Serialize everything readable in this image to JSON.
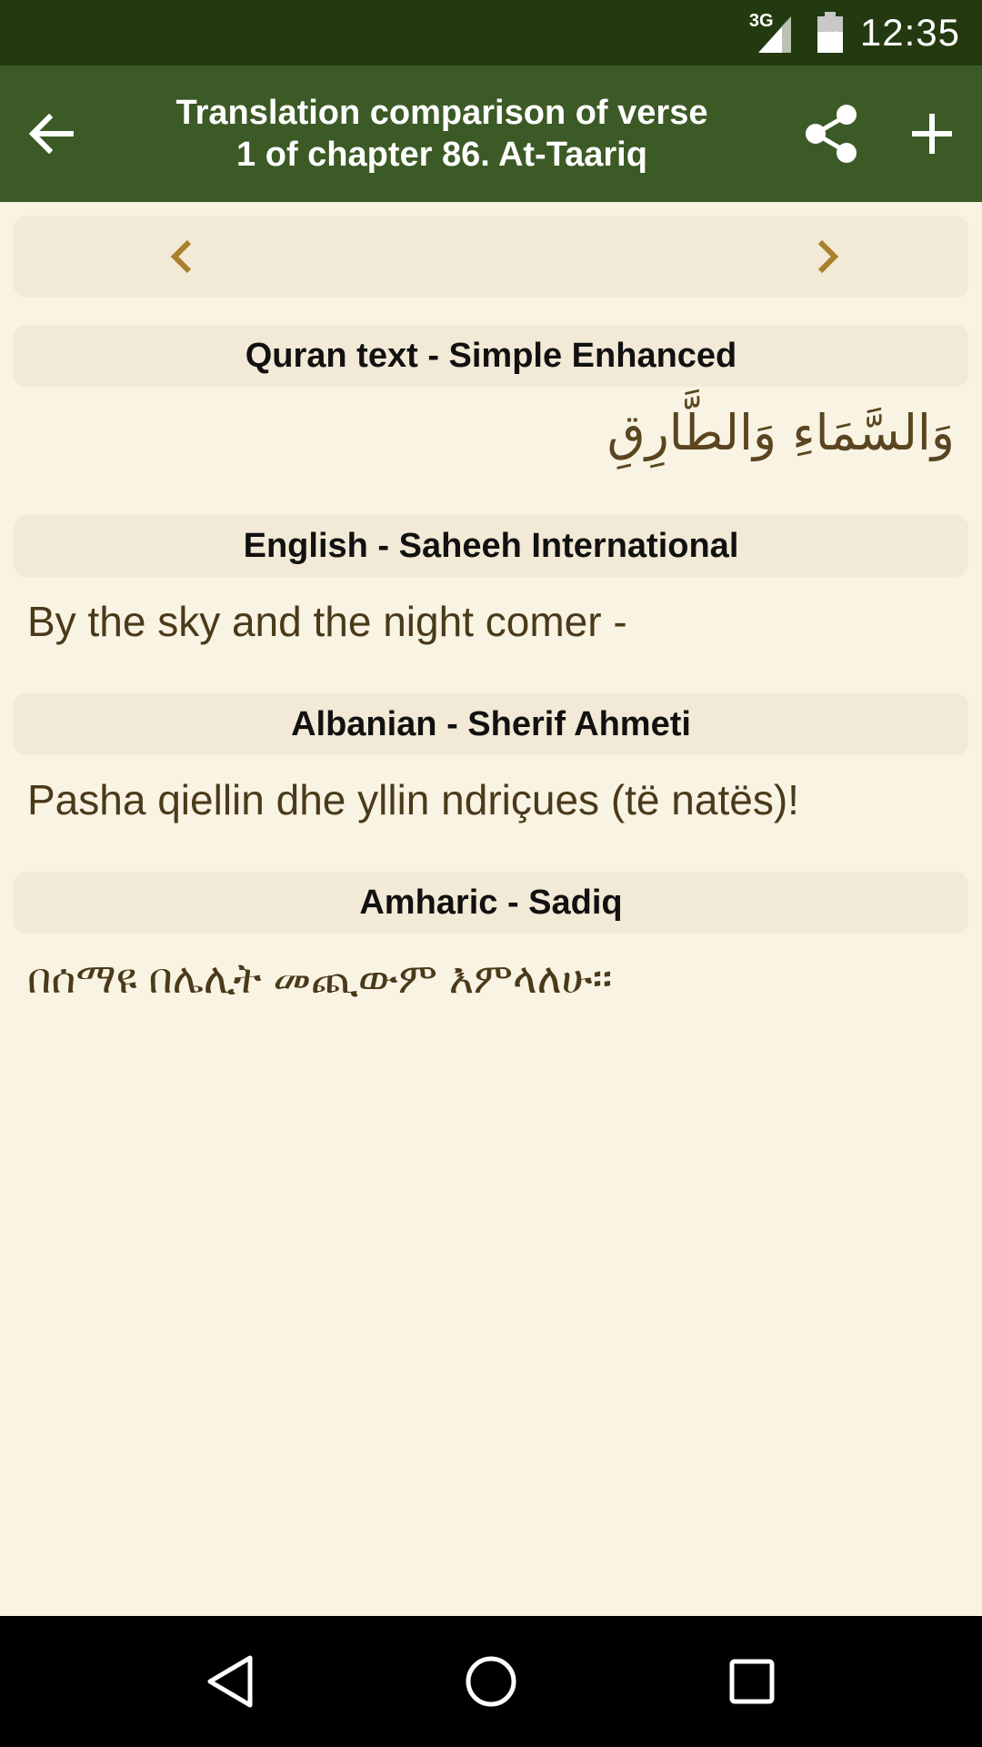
{
  "status": {
    "network": "3G",
    "time": "12:35"
  },
  "appbar": {
    "title_line1": "Translation comparison of verse",
    "title_line2": "1 of chapter 86. At-Taariq",
    "back_icon": "arrow-left-icon",
    "share_icon": "share-icon",
    "add_icon": "plus-icon"
  },
  "colors": {
    "status_bar": "#233a10",
    "app_bar": "#3c5a25",
    "background": "#f9f3e3",
    "section_header": "#f2e9d6",
    "accent_chevron": "#a8802e"
  },
  "sections": [
    {
      "header": "Quran text - Simple Enhanced",
      "text": "وَالسَّمَاءِ وَالطَّارِقِ"
    },
    {
      "header": "English - Saheeh International",
      "text": "By the sky and the night comer -"
    },
    {
      "header": "Albanian - Sherif Ahmeti",
      "text": "Pasha qiellin dhe yllin ndriçues (të natës)!"
    },
    {
      "header": "Amharic - Sadiq",
      "text": "በሰማዩ በሌሊት መጪውም እምላለሁ፡፡"
    }
  ]
}
